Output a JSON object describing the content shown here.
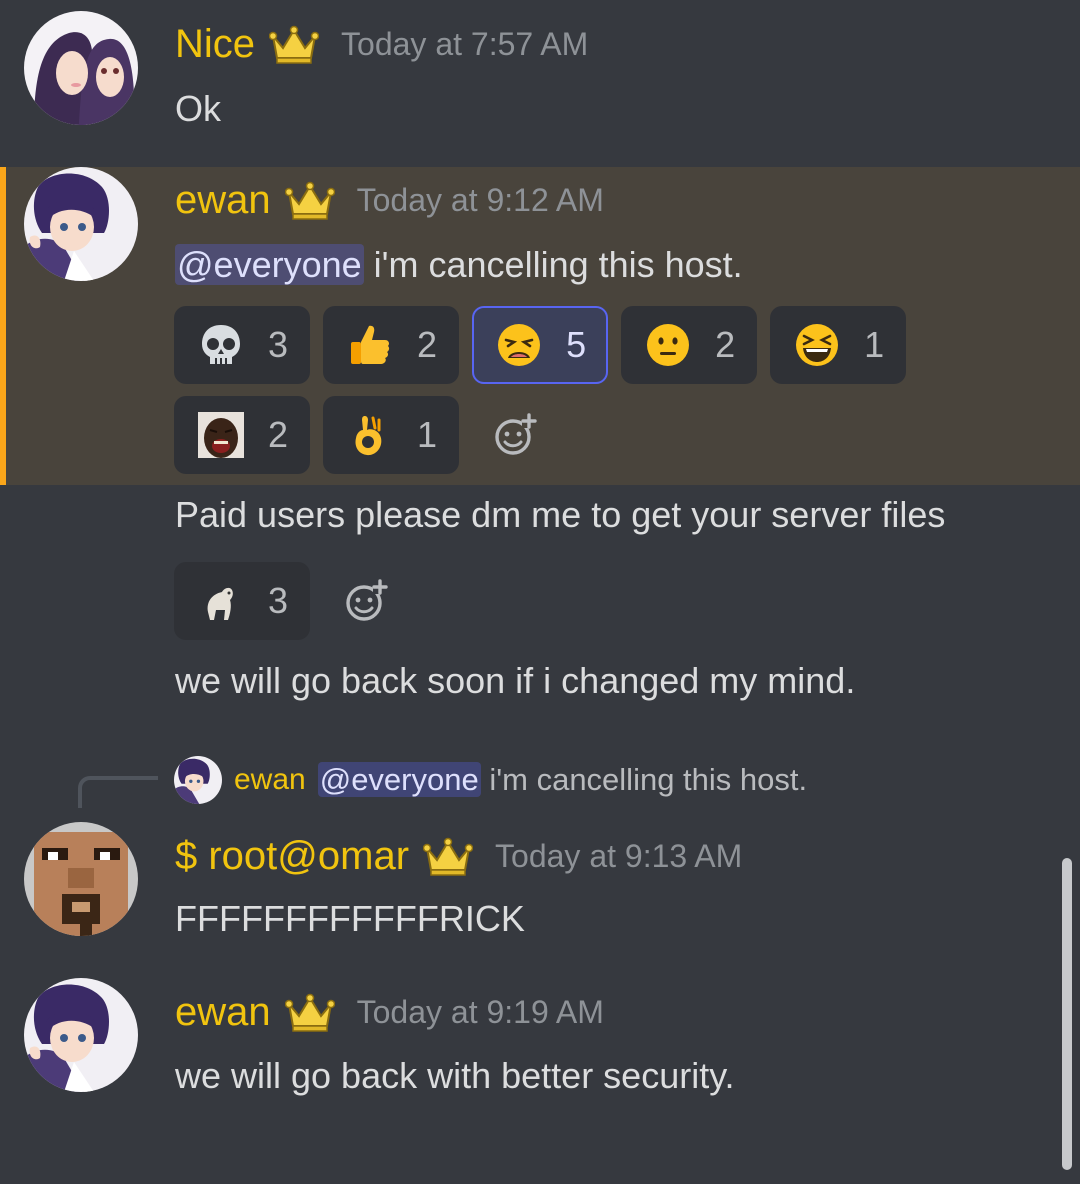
{
  "messages": [
    {
      "username": "Nice",
      "timestamp": "Today at 7:57 AM",
      "text": "Ok",
      "role_icon": "crown-icon"
    },
    {
      "username": "ewan",
      "timestamp": "Today at 9:12 AM",
      "mention": "@everyone",
      "text": " i'm cancelling this host.",
      "role_icon": "crown-icon",
      "highlighted": true,
      "reactions_row1": [
        {
          "emoji": "skull-emoji",
          "count": "3"
        },
        {
          "emoji": "thumbs-up-emoji",
          "count": "2"
        },
        {
          "emoji": "weary-face-emoji",
          "count": "5",
          "selected": true
        },
        {
          "emoji": "neutral-face-emoji",
          "count": "2"
        },
        {
          "emoji": "laughing-face-emoji",
          "count": "1"
        }
      ],
      "reactions_row2": [
        {
          "emoji": "custom-crying-man-emoji",
          "count": "2"
        },
        {
          "emoji": "ok-hand-emoji",
          "count": "1"
        }
      ]
    },
    {
      "text": "Paid users please dm me to get your server files",
      "reactions": [
        {
          "emoji": "custom-dog-emoji",
          "count": "3"
        }
      ]
    },
    {
      "text": "we will go back soon if i changed my mind."
    },
    {
      "reply_to": {
        "username": "ewan",
        "mention": "@everyone",
        "text": " i'm cancelling this host."
      },
      "username": "$ root@omar",
      "timestamp": "Today at 9:13 AM",
      "text": "FFFFFFFFFFFFRICK",
      "role_icon": "crown-icon"
    },
    {
      "username": "ewan",
      "timestamp": "Today at 9:19 AM",
      "text": "we will go back with better security.",
      "role_icon": "crown-icon"
    }
  ],
  "colors": {
    "background": "#36393f",
    "highlight": "#49443c",
    "highlight_bar": "#faa61a",
    "username": "#f1c40f",
    "timestamp": "#8e9297",
    "mention_bg": "#5865f2",
    "reaction_bg": "#2f3136"
  }
}
